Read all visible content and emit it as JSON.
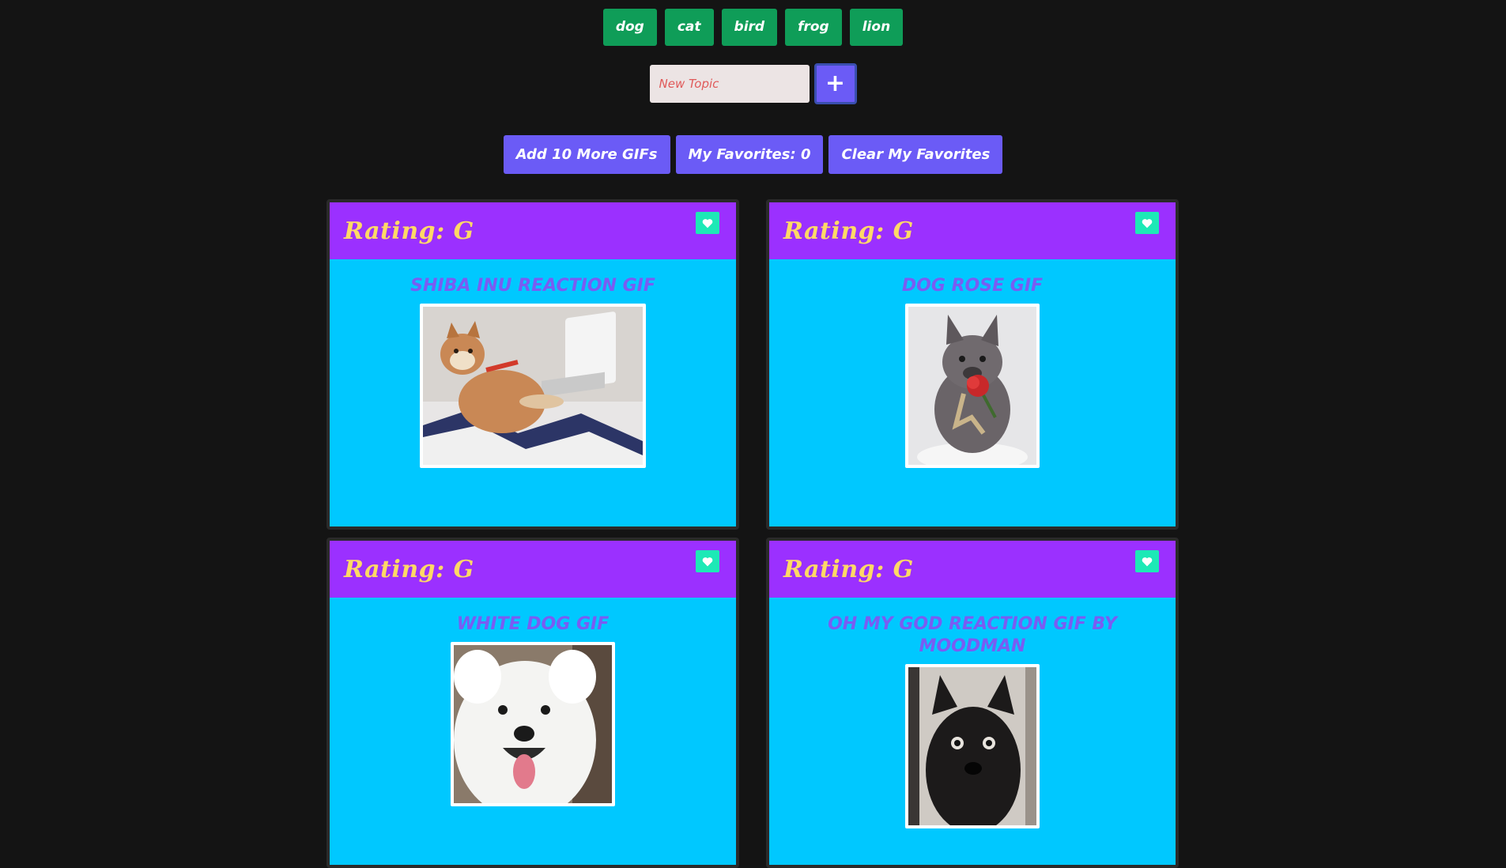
{
  "topics": [
    "dog",
    "cat",
    "bird",
    "frog",
    "lion"
  ],
  "new_topic": {
    "placeholder": "New Topic",
    "value": ""
  },
  "add_topic_button": "+",
  "actions": {
    "add_more": "Add 10 More GIFs",
    "favorites": "My Favorites: 0",
    "clear": "Clear My Favorites"
  },
  "cards": [
    {
      "rating": "Rating: G",
      "title": "shiba inu reaction gif",
      "image": "shiba-inu-on-laptop"
    },
    {
      "rating": "Rating: G",
      "title": "dog rose gif",
      "image": "french-bulldog-with-rose"
    },
    {
      "rating": "Rating: G",
      "title": "white dog gif",
      "image": "smiling-samoyed"
    },
    {
      "rating": "Rating: G",
      "title": "oh my god reaction gif by moodman",
      "image": "surprised-black-dog"
    }
  ],
  "colors": {
    "background": "#141414",
    "topic_button": "#0f9d58",
    "action_button": "#6b5bf6",
    "card_header": "#9b30ff",
    "card_body": "#00c8ff",
    "rating_text": "#ffd966",
    "title_text": "#7a5cf2",
    "favorite_button": "#1de9b6"
  }
}
